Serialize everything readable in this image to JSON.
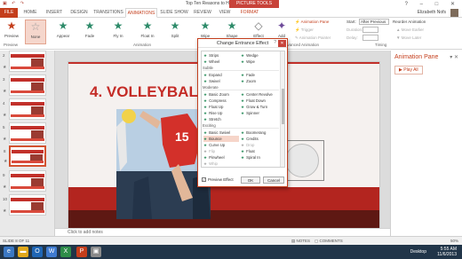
{
  "window": {
    "title": "Top Ten Reasons to Hire Me (W) - PowerPoint",
    "context_tab": "PICTURE TOOLS",
    "qat_icons": [
      "save-icon",
      "undo-icon",
      "redo-icon"
    ],
    "controls": [
      "?",
      "–",
      "□",
      "✕"
    ]
  },
  "tabs": [
    "FILE",
    "HOME",
    "INSERT",
    "DESIGN",
    "TRANSITIONS",
    "ANIMATIONS",
    "SLIDE SHOW",
    "REVIEW",
    "VIEW",
    "FORMAT"
  ],
  "active_tab": "ANIMATIONS",
  "user": "Elizabeth Nofs",
  "ribbon": {
    "preview": "Preview",
    "preview_group": "Preview",
    "animation_group": "Animation",
    "effects": [
      "None",
      "Appear",
      "Fade",
      "Fly In",
      "Float In",
      "Split",
      "Wipe",
      "Shape"
    ],
    "effect_options": "Effect",
    "add_animation": "Add",
    "advanced_group": "Advanced Animation",
    "animation_pane": "Animation Pane",
    "trigger": "Trigger",
    "animation_painter": "Animation Painter",
    "start_label": "Start:",
    "start_value": "After Previous",
    "duration_label": "Duration:",
    "delay_label": "Delay:",
    "timing_group": "Timing",
    "reorder": "Reorder Animation",
    "move_earlier": "Move Earlier",
    "move_later": "Move Later"
  },
  "slides": {
    "numbers": [
      "1",
      "2",
      "3",
      "4",
      "5",
      "6",
      "7",
      "8",
      "9",
      "10"
    ],
    "selected": "8"
  },
  "slide": {
    "heading": "4. VOLLEYBALL",
    "jersey_number": "15"
  },
  "notes_placeholder": "Click to add notes",
  "animation_pane": {
    "title": "Animation Pane",
    "play_all": "Play All"
  },
  "dialog": {
    "title": "Change Entrance Effect",
    "help": "?",
    "close": "✕",
    "rows_top": [
      [
        "Strips",
        "Wedge"
      ],
      [
        "Wheel",
        "Wipe"
      ]
    ],
    "categories": [
      {
        "name": "Subtle",
        "rows": [
          [
            "Expand",
            "Fade"
          ],
          [
            "Swivel",
            "Zoom"
          ]
        ]
      },
      {
        "name": "Moderate",
        "rows": [
          [
            "Basic Zoom",
            "Center Revolve"
          ],
          [
            "Compress",
            "Float Down"
          ],
          [
            "Float Up",
            "Grow & Turn"
          ],
          [
            "Rise Up",
            "Spinner"
          ],
          [
            "Stretch",
            ""
          ]
        ]
      },
      {
        "name": "Exciting",
        "rows": [
          [
            "Basic Swivel",
            "Boomerang"
          ],
          [
            "Bounce",
            "Credits"
          ],
          [
            "Curve Up",
            "Drop"
          ],
          [
            "Flip",
            "Float"
          ],
          [
            "Pinwheel",
            "Spiral In"
          ],
          [
            "Whip",
            ""
          ]
        ]
      }
    ],
    "selected_effect": "Bounce",
    "dim_effects": [
      "Drop",
      "Flip",
      "Whip"
    ],
    "preview_label": "Preview Effect",
    "ok": "OK",
    "cancel": "Cancel"
  },
  "status": {
    "slide_info": "SLIDE 8 OF 11",
    "notes": "NOTES",
    "comments": "COMMENTS",
    "zoom": "50%"
  },
  "taskbar": {
    "desktop": "Desktop",
    "time": "5:55 AM",
    "date": "11/6/2013"
  },
  "colors": {
    "accent": "#c43e1c",
    "slide_red": "#c42b26",
    "taskbar": "#213549"
  }
}
